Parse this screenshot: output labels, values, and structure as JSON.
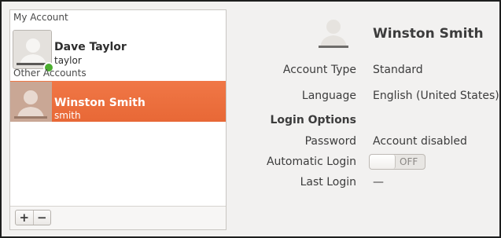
{
  "sidebar": {
    "my_account_header": "My Account",
    "other_accounts_header": "Other Accounts",
    "users": [
      {
        "name": "Dave Taylor",
        "login": "taylor",
        "online": true
      },
      {
        "name": "Winston Smith",
        "login": "smith",
        "selected": true
      }
    ],
    "add_label": "+",
    "remove_label": "−"
  },
  "details": {
    "name": "Winston Smith",
    "account_type_label": "Account Type",
    "account_type_value": "Standard",
    "language_label": "Language",
    "language_value": "English (United States)",
    "login_options_label": "Login Options",
    "password_label": "Password",
    "password_value": "Account disabled",
    "auto_login_label": "Automatic Login",
    "auto_login_state": "OFF",
    "last_login_label": "Last Login",
    "last_login_value": "—"
  },
  "colors": {
    "selection": "#e96a37",
    "online": "#4cae30",
    "background": "#f2f1f0"
  }
}
